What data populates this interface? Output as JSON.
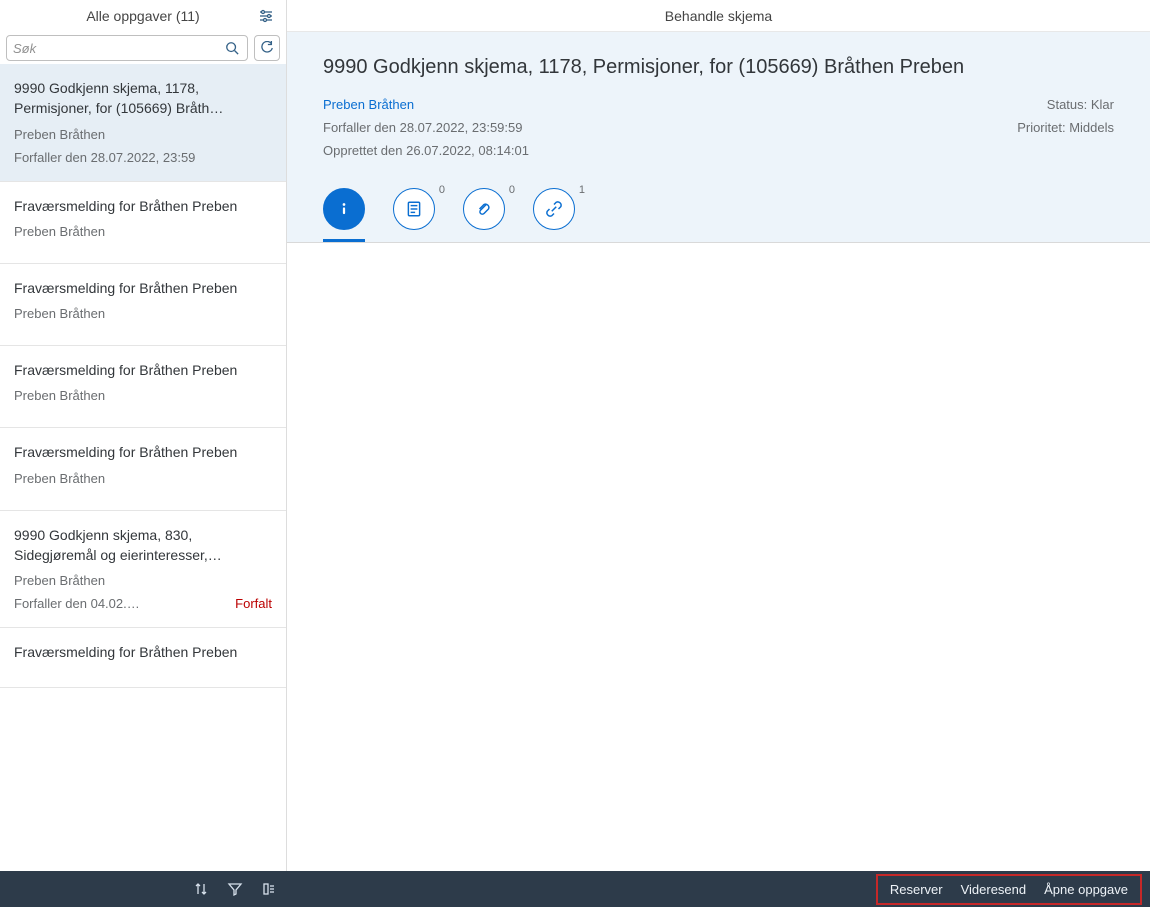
{
  "sidebar": {
    "title": "Alle oppgaver (11)",
    "search_placeholder": "Søk",
    "tasks": [
      {
        "title": "9990 Godkjenn skjema, 1178, Permisjoner, for (105669) Bråth…",
        "author": "Preben Bråthen",
        "due": "Forfaller den 28.07.2022, 23:59",
        "overdue": "",
        "selected": true
      },
      {
        "title": "Fraværsmelding for Bråthen Preben",
        "author": "Preben Bråthen",
        "due": "",
        "overdue": "",
        "selected": false
      },
      {
        "title": "Fraværsmelding for Bråthen Preben",
        "author": "Preben Bråthen",
        "due": "",
        "overdue": "",
        "selected": false
      },
      {
        "title": "Fraværsmelding for Bråthen Preben",
        "author": "Preben Bråthen",
        "due": "",
        "overdue": "",
        "selected": false
      },
      {
        "title": "Fraværsmelding for Bråthen Preben",
        "author": "Preben Bråthen",
        "due": "",
        "overdue": "",
        "selected": false
      },
      {
        "title": "9990 Godkjenn skjema, 830, Sidegjøremål og eierinteresser,…",
        "author": "Preben Bråthen",
        "due": "Forfaller den 04.02.…",
        "overdue": "Forfalt",
        "selected": false
      },
      {
        "title": "Fraværsmelding for Bråthen Preben",
        "author": "",
        "due": "",
        "overdue": "",
        "selected": false
      }
    ]
  },
  "main": {
    "header_title": "Behandle skjema",
    "detail_title": "9990 Godkjenn skjema, 1178, Permisjoner, for (105669) Bråthen Preben",
    "author_link": "Preben Bråthen",
    "due_line": "Forfaller den 28.07.2022, 23:59:59",
    "created_line": "Opprettet den 26.07.2022, 08:14:01",
    "status_line": "Status: Klar",
    "priority_line": "Prioritet: Middels",
    "tabs": {
      "info_badge": "",
      "notes_badge": "0",
      "attach_badge": "0",
      "link_badge": "1"
    }
  },
  "footer": {
    "reserve": "Reserver",
    "forward": "Videresend",
    "open": "Åpne oppgave"
  }
}
